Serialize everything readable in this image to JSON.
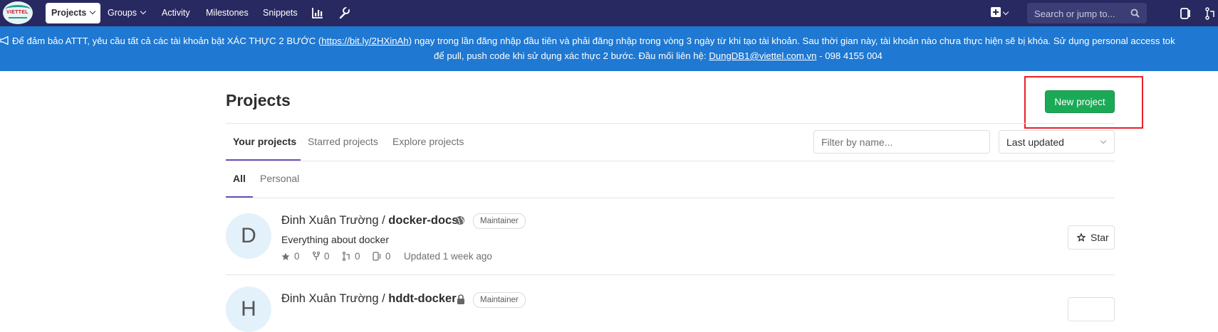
{
  "navbar": {
    "items": [
      {
        "label": "Projects"
      },
      {
        "label": "Groups"
      },
      {
        "label": "Activity"
      },
      {
        "label": "Milestones"
      },
      {
        "label": "Snippets"
      }
    ],
    "search_placeholder": "Search or jump to...",
    "colors": {
      "background": "#292961",
      "search_bg": "#3d3d76"
    },
    "icons": [
      "viettel-logo",
      "chart-icon",
      "wrench-icon",
      "plus-square-icon",
      "search-icon",
      "issues-icon",
      "merge-request-icon"
    ]
  },
  "banner": {
    "icon": "megaphone-icon",
    "line1_pre": "Để đảm bảo ATTT, yêu cầu tất cả các tài khoản bật XÁC THỰC 2 BƯỚC (",
    "line1_link": "https://bit.ly/2HXinAh",
    "line1_post": ") ngay trong lần đăng nhập đầu tiên và phải đăng nhập trong vòng 3 ngày từ khi tạo tài khoản. Sau thời gian này, tài khoản nào chưa thực hiện sẽ bị khóa. Sử dụng personal access tok",
    "line2_pre": "để pull, push code khi sử dụng xác thực 2 bước. Đầu mối liên hệ: ",
    "line2_email": "DungDB1@viettel.com.vn",
    "line2_post": " - 098 4155 004",
    "color": "#1f78d1"
  },
  "page": {
    "title": "Projects",
    "new_project_label": "New project",
    "accent": "#1aaa55"
  },
  "tabs": [
    {
      "label": "Your projects",
      "active": true
    },
    {
      "label": "Starred projects",
      "active": false
    },
    {
      "label": "Explore projects",
      "active": false
    }
  ],
  "filter": {
    "placeholder": "Filter by name...",
    "value": ""
  },
  "sort": {
    "selected": "Last updated"
  },
  "subtabs": [
    {
      "label": "All",
      "active": true
    },
    {
      "label": "Personal",
      "active": false
    }
  ],
  "projects": [
    {
      "avatar_letter": "D",
      "namespace": "Đinh Xuân Trường / ",
      "name": "docker-docs",
      "visibility_icon": "globe-icon",
      "role": "Maintainer",
      "description": "Everything about docker",
      "stars": "0",
      "forks": "0",
      "merge_requests": "0",
      "issues": "0",
      "updated": "Updated 1 week ago",
      "star_label": "Star"
    },
    {
      "avatar_letter": "H",
      "namespace": "Đinh Xuân Trường / ",
      "name": "hddt-docker",
      "visibility_icon": "lock-icon",
      "role": "Maintainer"
    }
  ]
}
